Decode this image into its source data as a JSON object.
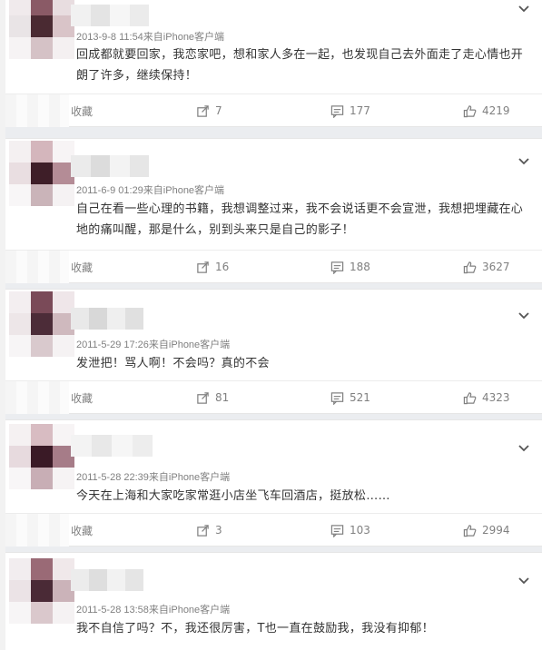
{
  "posts": [
    {
      "meta": "2013-9-8 11:54来自iPhone客户端",
      "content": "回成都就要回家，我恋家吧，想和家人多在一起，也发现自己去外面走了走心情也开朗了许多，继续保持！",
      "favorite_label": "收藏",
      "forward_count": "7",
      "comment_count": "177",
      "like_count": "4219"
    },
    {
      "meta": "2011-6-9 01:29来自iPhone客户端",
      "content": "自己在看一些心理的书籍，我想调整过来，我不会说话更不会宣泄，我想把埋藏在心地的痛叫醒，那是什么，别到头来只是自己的影子！",
      "favorite_label": "收藏",
      "forward_count": "16",
      "comment_count": "188",
      "like_count": "3627"
    },
    {
      "meta": "2011-5-29 17:26来自iPhone客户端",
      "content": "发泄把！骂人啊！不会吗？真的不会",
      "favorite_label": "收藏",
      "forward_count": "81",
      "comment_count": "521",
      "like_count": "4323"
    },
    {
      "meta": "2011-5-28 22:39来自iPhone客户端",
      "content": "今天在上海和大家吃家常逛小店坐飞车回酒店，挺放松……",
      "favorite_label": "收藏",
      "forward_count": "3",
      "comment_count": "103",
      "like_count": "2994"
    },
    {
      "meta": "2011-5-28 13:58来自iPhone客户端",
      "content": "我不自信了吗？不，我还很厉害，T也一直在鼓励我，我没有抑郁！",
      "favorite_label": "",
      "forward_count": "",
      "comment_count": "",
      "like_count": ""
    }
  ],
  "icons": {
    "favorite": "star-icon",
    "forward": "forward-icon",
    "comment": "comment-icon",
    "like": "thumbs-up-icon",
    "expand": "chevron-down-icon"
  },
  "colors": {
    "meta_text": "#808080",
    "body_text": "#333333",
    "avatar_dark": "#4a2a32",
    "avatar_mid": "#8a5a66",
    "avatar_light": "#d9c4c8"
  }
}
